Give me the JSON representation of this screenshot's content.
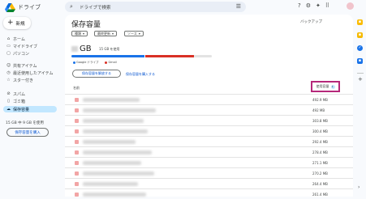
{
  "app": {
    "title": "ドライブ"
  },
  "search": {
    "placeholder": "ドライブで検索"
  },
  "top_icons": [
    "help-icon",
    "settings-icon",
    "gemini-icon",
    "apps-icon"
  ],
  "new_button": {
    "label": "新規"
  },
  "sidebar": {
    "items": [
      {
        "label": "ホーム",
        "icon": "home-icon"
      },
      {
        "label": "マイドライブ",
        "icon": "drive-icon"
      },
      {
        "label": "パソコン",
        "icon": "computer-icon"
      },
      {
        "label": "共有アイテム",
        "icon": "shared-icon"
      },
      {
        "label": "最近使用したアイテム",
        "icon": "clock-icon"
      },
      {
        "label": "スター付き",
        "icon": "star-icon"
      },
      {
        "label": "スパム",
        "icon": "spam-icon"
      },
      {
        "label": "ゴミ箱",
        "icon": "trash-icon"
      },
      {
        "label": "保存容量",
        "icon": "cloud-icon"
      }
    ],
    "storage_text": "15 GB 中 9 GB を使用",
    "buy_button": "保存容量を購入"
  },
  "main": {
    "title": "保存容量",
    "backup_link": "バックアップ",
    "filters": [
      "種類",
      "最終更新",
      "ソース"
    ],
    "usage_value": "GB",
    "usage_sub": "15 GB を使用",
    "legend": [
      {
        "label": "Google ドライブ",
        "color": "#1a73e8"
      },
      {
        "label": "Gmail",
        "color": "#d93025"
      }
    ],
    "button_primary": "保存容量を解放する",
    "button_secondary": "保存容量を購入する",
    "column_name": "名前",
    "column_size": "使用容量"
  },
  "files": [
    {
      "size": "492.9 MB"
    },
    {
      "size": "492 MB"
    },
    {
      "size": "303.8 MB"
    },
    {
      "size": "300.4 MB"
    },
    {
      "size": "292.4 MB"
    },
    {
      "size": "278.4 MB"
    },
    {
      "size": "271.1 MB"
    },
    {
      "size": "270.2 MB"
    },
    {
      "size": "264.4 MB"
    },
    {
      "size": "261.4 MB"
    }
  ],
  "colors": {
    "accent": "#0b57d0",
    "active_nav": "#c2e7ff",
    "highlight_box": "#b5287a"
  }
}
